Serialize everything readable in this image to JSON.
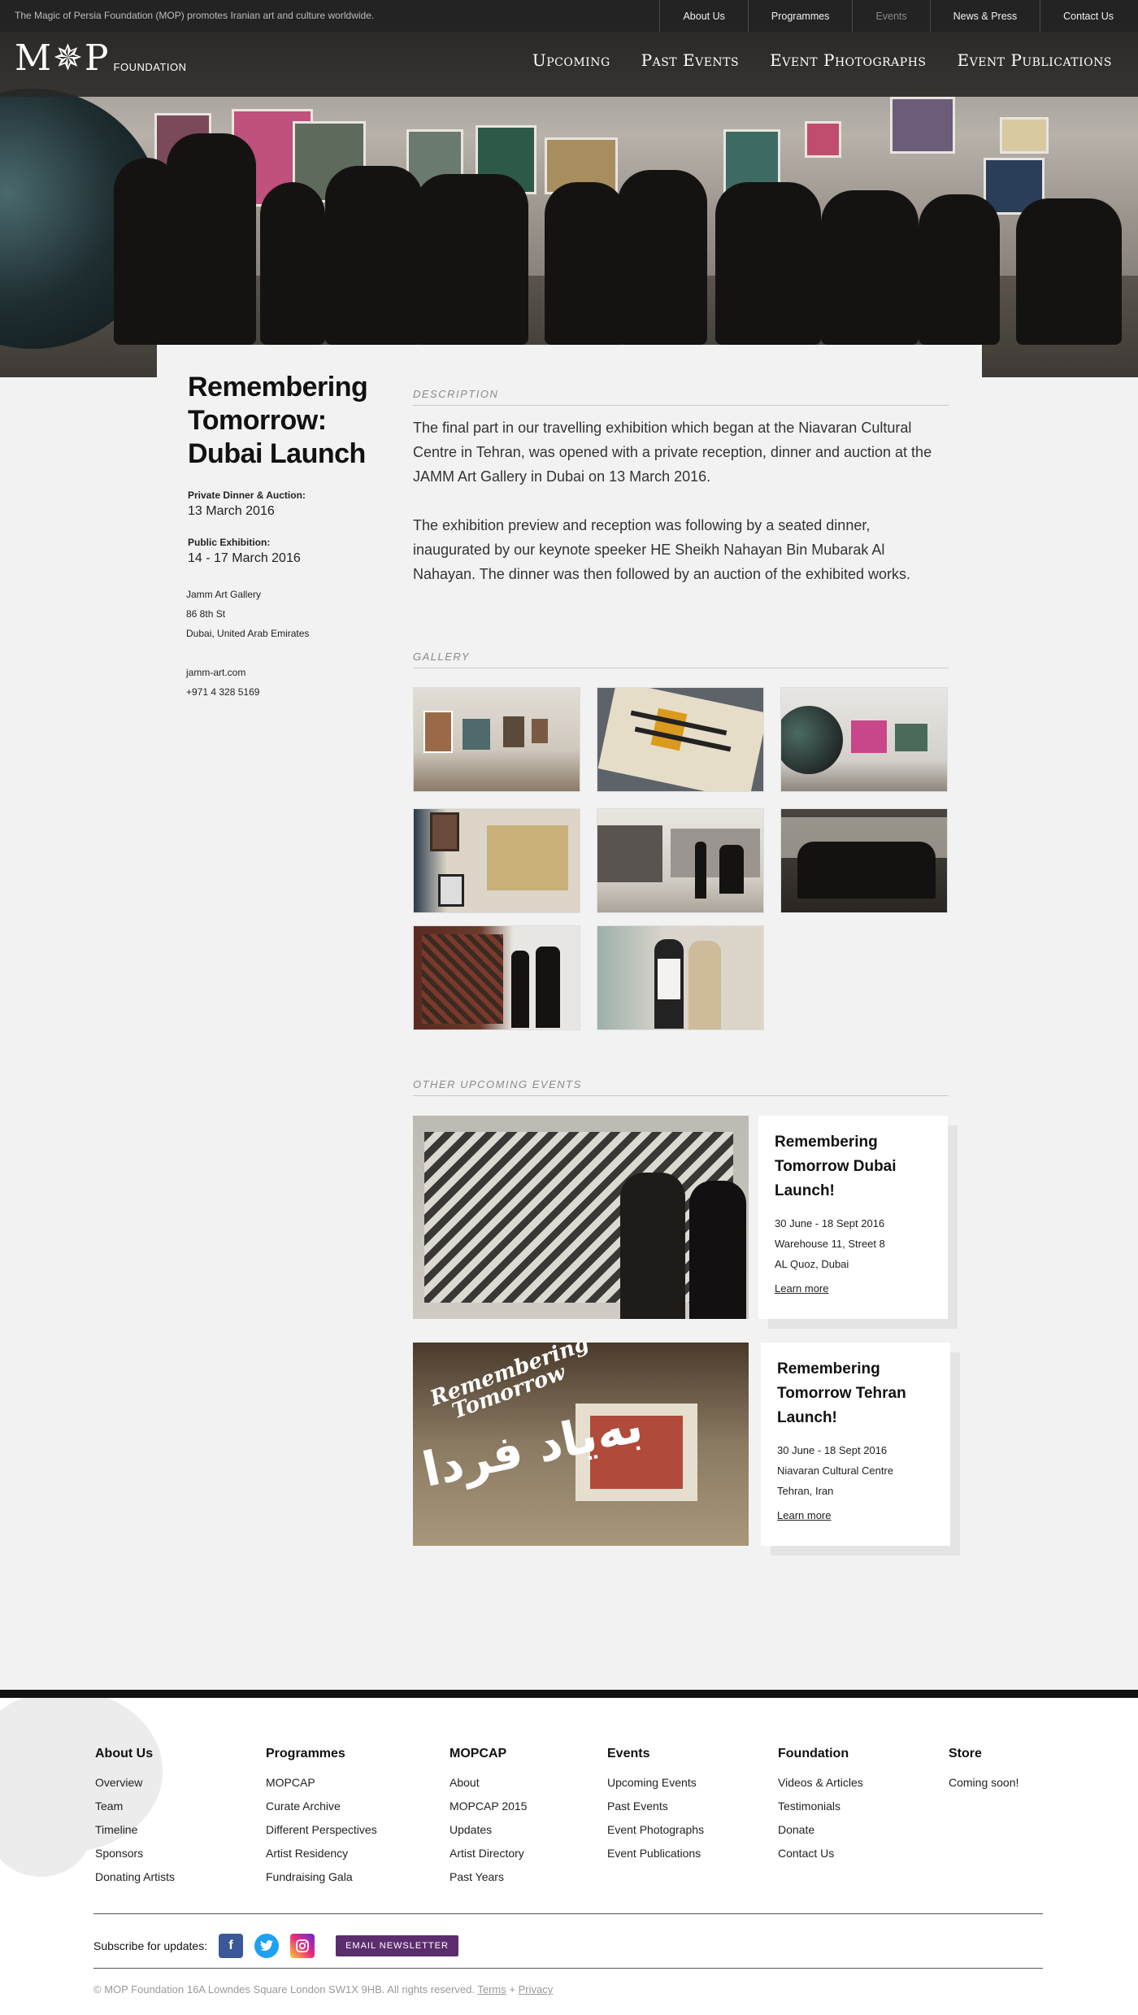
{
  "topbar": {
    "tagline": "The Magic of Persia Foundation (MOP) promotes Iranian art and culture worldwide.",
    "nav": [
      "About Us",
      "Programmes",
      "Events",
      "News & Press",
      "Contact Us"
    ]
  },
  "header": {
    "logo_mark": "M✵P",
    "logo_word": "FOUNDATION",
    "nav": [
      "Upcoming",
      "Past Events",
      "Event Photographs",
      "Event Publications"
    ]
  },
  "event": {
    "title": "Remembering Tomorrow: Dubai Launch",
    "dinner_label": "Private Dinner & Auction:",
    "dinner_date": "13 March 2016",
    "public_label": "Public Exhibition:",
    "public_date": "14  - 17 March 2016",
    "venue": "Jamm Art Gallery",
    "street": "86 8th St",
    "city": "Dubai, United Arab Emirates",
    "website": "jamm-art.com",
    "phone": "+971 4 328 5169"
  },
  "description": {
    "heading": "DESCRIPTION",
    "p1": "The final part in our travelling exhibition which began at the Niavaran Cultural Centre in Tehran, was opened with a private reception, dinner and auction at the JAMM Art Gallery in Dubai on 13 March 2016.",
    "p2": "The exhibition preview and reception was following by a seated dinner, inaugurated by our keynote speeker HE Sheikh Nahayan Bin Mubarak Al Nahayan. The dinner was then followed by an auction of the exhibited works."
  },
  "gallery": {
    "heading": "GALLERY"
  },
  "other_events": {
    "heading": "OTHER UPCOMING EVENTS",
    "items": [
      {
        "title": "Remembering Tomorrow Dubai Launch!",
        "dates": "30 June - 18 Sept 2016",
        "line1": "Warehouse 11, Street 8",
        "line2": "AL Quoz, Dubai",
        "link": "Learn more"
      },
      {
        "title": "Remembering Tomorrow Tehran Launch!",
        "dates": "30 June - 18 Sept 2016",
        "line1": "Niavaran Cultural Centre",
        "line2": "Tehran, Iran",
        "link": "Learn more",
        "poster_text_1": "Remembering",
        "poster_text_2": "Tomorrow",
        "poster_text_3": "به‌یاد فردا"
      }
    ]
  },
  "footer": {
    "columns": [
      {
        "heading": "About Us",
        "links": [
          "Overview",
          "Team",
          "Timeline",
          "Sponsors",
          "Donating Artists"
        ]
      },
      {
        "heading": "Programmes",
        "links": [
          "MOPCAP",
          "Curate Archive",
          "Different Perspectives",
          "Artist Residency",
          "Fundraising Gala"
        ]
      },
      {
        "heading": "MOPCAP",
        "links": [
          "About",
          "MOPCAP 2015",
          "Updates",
          "Artist Directory",
          "Past Years"
        ]
      },
      {
        "heading": "Events",
        "links": [
          "Upcoming Events",
          "Past Events",
          "Event Photographs",
          "Event Publications"
        ]
      },
      {
        "heading": "Foundation",
        "links": [
          "Videos & Articles",
          "Testimonials",
          "Donate",
          "Contact Us"
        ]
      },
      {
        "heading": "Store",
        "links": [
          "Coming soon!"
        ]
      }
    ],
    "subscribe_label": "Subscribe for updates:",
    "newsletter_button": "EMAIL NEWSLETTER",
    "copyright": "© MOP Foundation 16A Lowndes Square London SW1X 9HB. All rights reserved.",
    "terms": "Terms",
    "plus": "+",
    "privacy": "Privacy",
    "colors": {
      "facebook": "#3b5998",
      "twitter": "#1da1f2",
      "instagram": "#c13584",
      "newsletter": "#5c2d6e"
    }
  }
}
